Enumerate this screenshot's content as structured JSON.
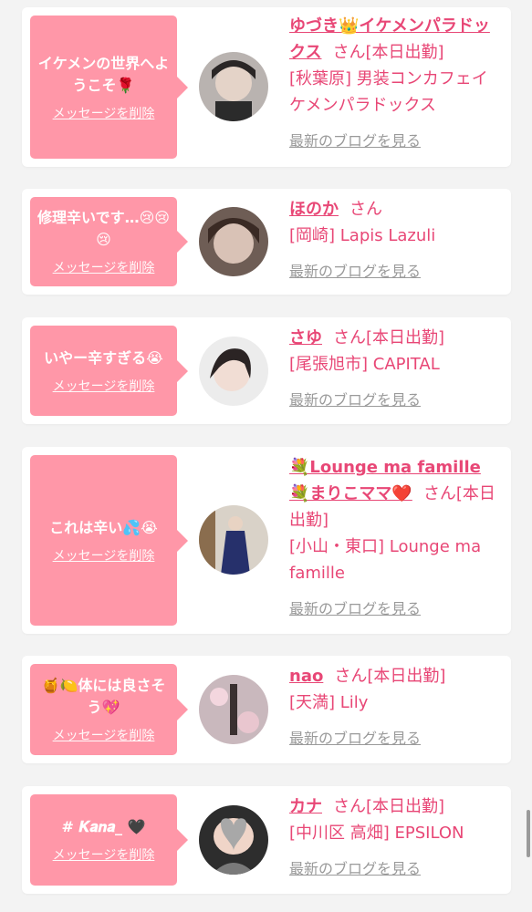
{
  "colors": {
    "accent": "#e84776",
    "bubble": "#ff97a8",
    "muted": "#9a9a9a",
    "background": "#f3f3f3"
  },
  "common": {
    "delete_label": "メッセージを削除",
    "blog_label": "最新のブログを見る",
    "san": "さん"
  },
  "cards": [
    {
      "message": "イケメンの世界へようこそ🌹",
      "name": "ゆづき👑イケメンパラドックス",
      "status": "[本日出勤]",
      "shop": "[秋葉原] 男装コンカフェイケメンパラドックス"
    },
    {
      "message": "修理辛いです…😢😢😢",
      "name": "ほのか",
      "status": "",
      "shop": "[岡崎] Lapis Lazuli"
    },
    {
      "message": "いやー辛すぎる😭",
      "name": "さゆ",
      "status": "[本日出勤]",
      "shop": "[尾張旭市] CAPITAL"
    },
    {
      "message": "これは辛い💦😭",
      "name": "💐Lounge ma famille💐まりこママ❤️",
      "status": "[本日出勤]",
      "shop": "[小山・東口] Lounge ma famille"
    },
    {
      "message": "🍯🍋体には良さそう💖",
      "name": "nao",
      "status": "[本日出勤]",
      "shop": "[天満] Lily"
    },
    {
      "message": "# 𝑲𝒂𝒏𝒂_ 🖤",
      "name": "カナ",
      "status": "[本日出勤]",
      "shop": "[中川区 高畑] EPSILON"
    }
  ]
}
